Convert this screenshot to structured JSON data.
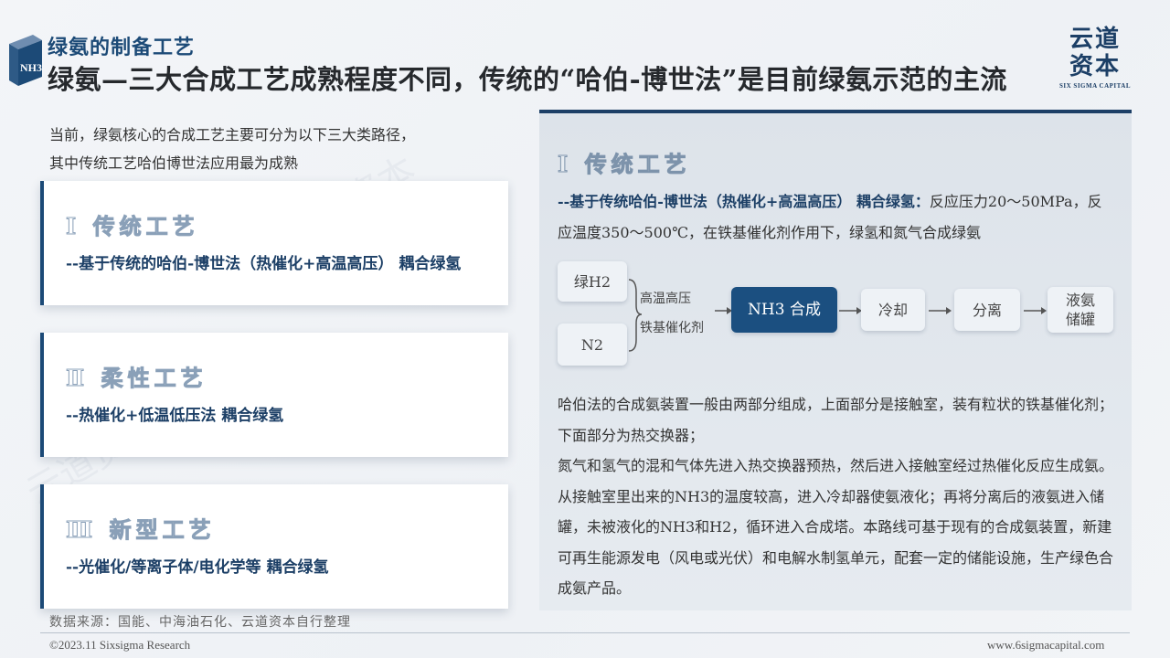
{
  "header": {
    "badge_text": "NH3",
    "subtitle": "绿氨的制备工艺",
    "title": "绿氨—三大合成工艺成熟程度不同，传统的“哈伯-博世法”是目前绿氨示范的主流",
    "brand_cn_line1": "云道",
    "brand_cn_line2": "资本",
    "brand_en": "SIX SIGMA CAPITAL"
  },
  "intro": {
    "line1": "当前，绿氨核心的合成工艺主要可分为以下三大类路径，",
    "line2": "其中传统工艺哈伯博世法应用最为成熟"
  },
  "cards": [
    {
      "head": "Ⅰ 传统工艺",
      "desc": "--基于传统的哈伯-博世法（热催化+高温高压） 耦合绿氢"
    },
    {
      "head": "Ⅱ 柔性工艺",
      "desc": "--热催化+低温低压法 耦合绿氢"
    },
    {
      "head": "Ⅲ 新型工艺",
      "desc": "--光催化/等离子体/电化学等 耦合绿氢"
    }
  ],
  "panel": {
    "head": "Ⅰ 传统工艺",
    "desc_bold": "--基于传统哈伯-博世法（热催化+高温高压） 耦合绿氢：",
    "desc_rest": "反应压力20～50MPa，反应温度350～500℃，在铁基催化剂作用下，绿氢和氮气合成绿氨",
    "flow": {
      "input1": "绿H2",
      "input2": "N2",
      "cond1": "高温高压",
      "cond2": "铁基催化剂",
      "step1": "NH3 合成",
      "step2": "冷却",
      "step3": "分离",
      "step4_line1": "液氨",
      "step4_line2": "储罐"
    },
    "body_p1": "哈伯法的合成氨装置一般由两部分组成，上面部分是接触室，装有粒状的铁基催化剂；下面部分为热交换器；",
    "body_p2": "氮气和氢气的混和气体先进入热交换器预热，然后进入接触室经过热催化反应生成氨。从接触室里出来的NH3的温度较高，进入冷却器使氨液化；再将分离后的液氨进入储罐，未被液化的NH3和H2，循环进入合成塔。本路线可基于现有的合成氨装置，新建可再生能源发电（风电或光伏）和电解水制氢单元，配套一定的储能设施，生产绿色合成氨产品。"
  },
  "footer": {
    "source": "数据来源：国能、中海油石化、云道资本自行整理",
    "copyright": "©2023.11 Sixsigma Research",
    "website": "www.6sigmacapital.com"
  }
}
